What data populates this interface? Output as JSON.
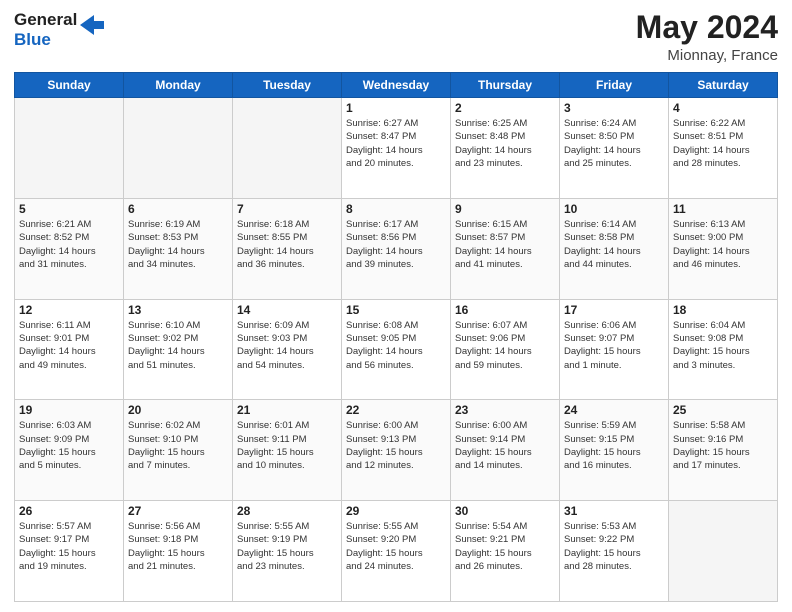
{
  "header": {
    "logo_general": "General",
    "logo_blue": "Blue",
    "title": "May 2024",
    "subtitle": "Mionnay, France"
  },
  "days_of_week": [
    "Sunday",
    "Monday",
    "Tuesday",
    "Wednesday",
    "Thursday",
    "Friday",
    "Saturday"
  ],
  "weeks": [
    [
      {
        "day": "",
        "info": ""
      },
      {
        "day": "",
        "info": ""
      },
      {
        "day": "",
        "info": ""
      },
      {
        "day": "1",
        "info": "Sunrise: 6:27 AM\nSunset: 8:47 PM\nDaylight: 14 hours\nand 20 minutes."
      },
      {
        "day": "2",
        "info": "Sunrise: 6:25 AM\nSunset: 8:48 PM\nDaylight: 14 hours\nand 23 minutes."
      },
      {
        "day": "3",
        "info": "Sunrise: 6:24 AM\nSunset: 8:50 PM\nDaylight: 14 hours\nand 25 minutes."
      },
      {
        "day": "4",
        "info": "Sunrise: 6:22 AM\nSunset: 8:51 PM\nDaylight: 14 hours\nand 28 minutes."
      }
    ],
    [
      {
        "day": "5",
        "info": "Sunrise: 6:21 AM\nSunset: 8:52 PM\nDaylight: 14 hours\nand 31 minutes."
      },
      {
        "day": "6",
        "info": "Sunrise: 6:19 AM\nSunset: 8:53 PM\nDaylight: 14 hours\nand 34 minutes."
      },
      {
        "day": "7",
        "info": "Sunrise: 6:18 AM\nSunset: 8:55 PM\nDaylight: 14 hours\nand 36 minutes."
      },
      {
        "day": "8",
        "info": "Sunrise: 6:17 AM\nSunset: 8:56 PM\nDaylight: 14 hours\nand 39 minutes."
      },
      {
        "day": "9",
        "info": "Sunrise: 6:15 AM\nSunset: 8:57 PM\nDaylight: 14 hours\nand 41 minutes."
      },
      {
        "day": "10",
        "info": "Sunrise: 6:14 AM\nSunset: 8:58 PM\nDaylight: 14 hours\nand 44 minutes."
      },
      {
        "day": "11",
        "info": "Sunrise: 6:13 AM\nSunset: 9:00 PM\nDaylight: 14 hours\nand 46 minutes."
      }
    ],
    [
      {
        "day": "12",
        "info": "Sunrise: 6:11 AM\nSunset: 9:01 PM\nDaylight: 14 hours\nand 49 minutes."
      },
      {
        "day": "13",
        "info": "Sunrise: 6:10 AM\nSunset: 9:02 PM\nDaylight: 14 hours\nand 51 minutes."
      },
      {
        "day": "14",
        "info": "Sunrise: 6:09 AM\nSunset: 9:03 PM\nDaylight: 14 hours\nand 54 minutes."
      },
      {
        "day": "15",
        "info": "Sunrise: 6:08 AM\nSunset: 9:05 PM\nDaylight: 14 hours\nand 56 minutes."
      },
      {
        "day": "16",
        "info": "Sunrise: 6:07 AM\nSunset: 9:06 PM\nDaylight: 14 hours\nand 59 minutes."
      },
      {
        "day": "17",
        "info": "Sunrise: 6:06 AM\nSunset: 9:07 PM\nDaylight: 15 hours\nand 1 minute."
      },
      {
        "day": "18",
        "info": "Sunrise: 6:04 AM\nSunset: 9:08 PM\nDaylight: 15 hours\nand 3 minutes."
      }
    ],
    [
      {
        "day": "19",
        "info": "Sunrise: 6:03 AM\nSunset: 9:09 PM\nDaylight: 15 hours\nand 5 minutes."
      },
      {
        "day": "20",
        "info": "Sunrise: 6:02 AM\nSunset: 9:10 PM\nDaylight: 15 hours\nand 7 minutes."
      },
      {
        "day": "21",
        "info": "Sunrise: 6:01 AM\nSunset: 9:11 PM\nDaylight: 15 hours\nand 10 minutes."
      },
      {
        "day": "22",
        "info": "Sunrise: 6:00 AM\nSunset: 9:13 PM\nDaylight: 15 hours\nand 12 minutes."
      },
      {
        "day": "23",
        "info": "Sunrise: 6:00 AM\nSunset: 9:14 PM\nDaylight: 15 hours\nand 14 minutes."
      },
      {
        "day": "24",
        "info": "Sunrise: 5:59 AM\nSunset: 9:15 PM\nDaylight: 15 hours\nand 16 minutes."
      },
      {
        "day": "25",
        "info": "Sunrise: 5:58 AM\nSunset: 9:16 PM\nDaylight: 15 hours\nand 17 minutes."
      }
    ],
    [
      {
        "day": "26",
        "info": "Sunrise: 5:57 AM\nSunset: 9:17 PM\nDaylight: 15 hours\nand 19 minutes."
      },
      {
        "day": "27",
        "info": "Sunrise: 5:56 AM\nSunset: 9:18 PM\nDaylight: 15 hours\nand 21 minutes."
      },
      {
        "day": "28",
        "info": "Sunrise: 5:55 AM\nSunset: 9:19 PM\nDaylight: 15 hours\nand 23 minutes."
      },
      {
        "day": "29",
        "info": "Sunrise: 5:55 AM\nSunset: 9:20 PM\nDaylight: 15 hours\nand 24 minutes."
      },
      {
        "day": "30",
        "info": "Sunrise: 5:54 AM\nSunset: 9:21 PM\nDaylight: 15 hours\nand 26 minutes."
      },
      {
        "day": "31",
        "info": "Sunrise: 5:53 AM\nSunset: 9:22 PM\nDaylight: 15 hours\nand 28 minutes."
      },
      {
        "day": "",
        "info": ""
      }
    ]
  ]
}
